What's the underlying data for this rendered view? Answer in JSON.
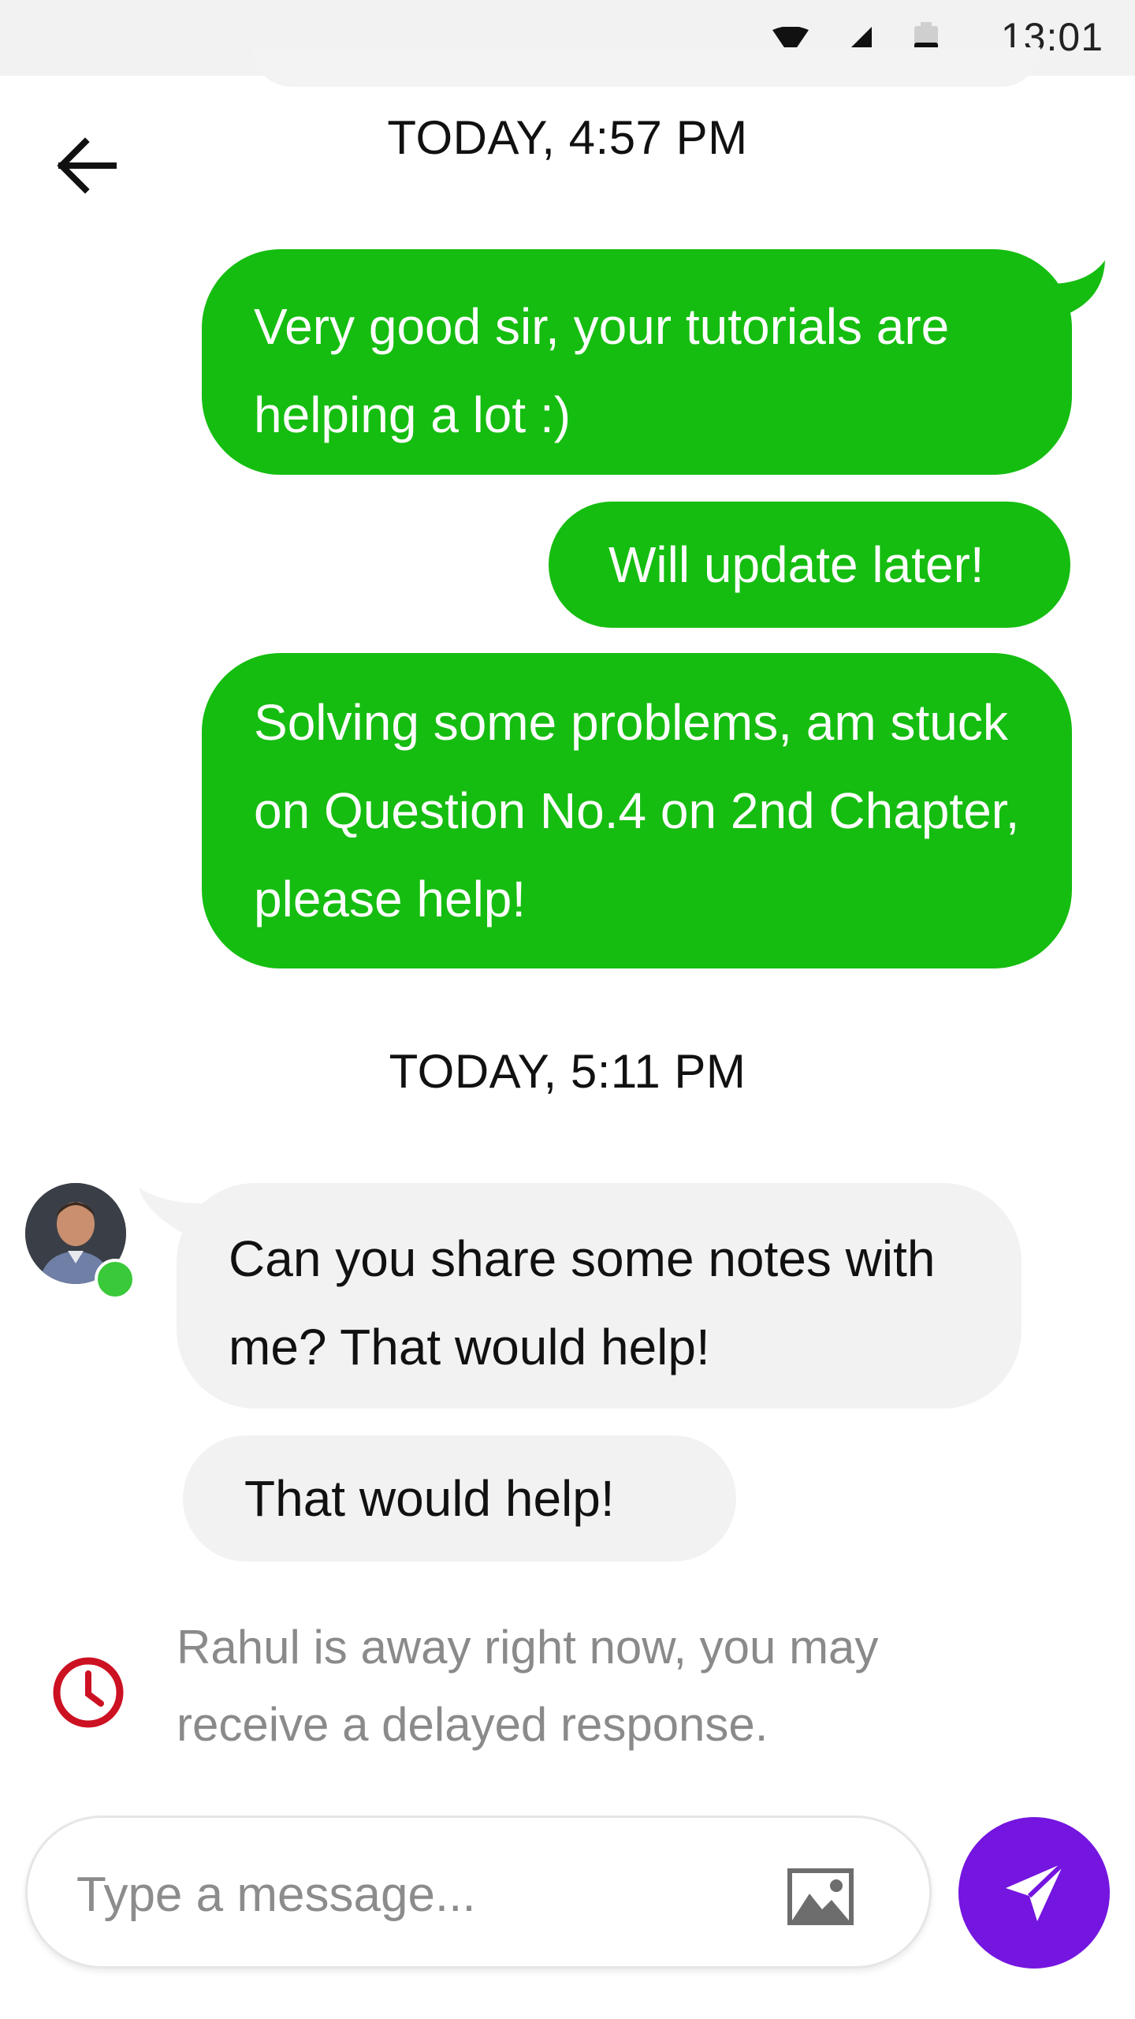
{
  "status_bar": {
    "time": "13:01"
  },
  "conversation": {
    "groups": [
      {
        "timestamp": "TODAY, 4:57 PM",
        "messages": [
          {
            "direction": "out",
            "text": "Very good sir, your tutorials are helping a lot :)"
          },
          {
            "direction": "out",
            "text": "Will update later!"
          },
          {
            "direction": "out",
            "text": "Solving some problems, am stuck on Question No.4 on 2nd Chapter, please help!"
          }
        ]
      },
      {
        "timestamp": "TODAY, 5:11 PM",
        "messages": [
          {
            "direction": "in",
            "text": "Can you share some notes with me? That would help!"
          },
          {
            "direction": "in",
            "text": "That would help!"
          }
        ]
      }
    ]
  },
  "away_notice": "Rahul is away right now, you may receive a delayed response.",
  "composer": {
    "placeholder": "Type a message...",
    "value": ""
  },
  "icons": {
    "back": "arrow-left-icon",
    "wifi": "wifi-icon",
    "signal": "cellular-signal-icon",
    "battery": "battery-icon",
    "clock": "clock-icon",
    "image": "image-icon",
    "send": "send-icon"
  },
  "colors": {
    "outgoing_bubble": "#15bd10",
    "incoming_bubble": "#f2f2f2",
    "send_button": "#7415e0",
    "away_icon": "#cc1122",
    "online_indicator": "#3ac93a"
  }
}
